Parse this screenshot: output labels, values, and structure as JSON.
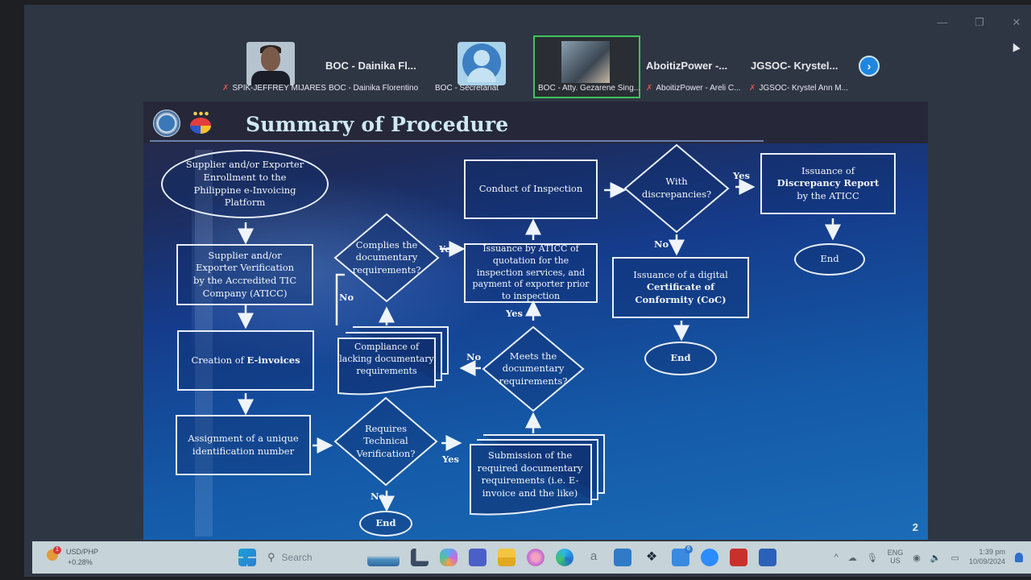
{
  "window_controls": {
    "minimize": "—",
    "maximize": "❐",
    "close": "✕"
  },
  "participants": {
    "tiles": [
      {
        "caption": "SPIK-JEFFREY MIJARES",
        "muted": true,
        "display": "photo",
        "icon": "person-photo"
      },
      {
        "big_name": "BOC - Dainika Fl...",
        "caption": "BOC - Dainika Florentino",
        "muted": false,
        "display": "name"
      },
      {
        "caption": "BOC - Secretariat",
        "muted": false,
        "display": "avatar",
        "icon": "default-avatar-icon"
      },
      {
        "caption": "BOC - Atty. Gezarene Sing...",
        "muted": false,
        "display": "video",
        "active_speaker": true
      },
      {
        "big_name": "AboitizPower -...",
        "caption": "AboitizPower - Areli C...",
        "muted": true,
        "display": "name"
      },
      {
        "big_name": "JGSOC- Krystel...",
        "caption": "JGSOC- Krystel Ann M...",
        "muted": true,
        "display": "name"
      }
    ],
    "next_icon": "›",
    "active_speaker_color": "#3fc35b",
    "muted_icon": "🎙"
  },
  "slide": {
    "title": "Summary of Procedure",
    "page_number": "2",
    "logos": [
      "bureau-of-customs-seal",
      "bagong-pilipinas-logo"
    ],
    "flowchart": {
      "start": "Supplier and/or Exporter Enrollment to the Philippine e-Invoicing Platform",
      "verification": "Supplier and/or Exporter Verification by the Accredited TIC Company (ATICC)",
      "creation": {
        "prefix": "Creation of ",
        "bold": "E-invoices"
      },
      "assignment": "Assignment of a unique identification number",
      "requires_tech": "Requires Technical Verification?",
      "submission": "Submission of the required documentary requirements (i.e. E-invoice and the like)",
      "meets_docs": "Meets the documentary requirements?",
      "compliance_lacking": "Compliance of lacking documentary requirements",
      "complies_docs": "Complies the documentary requirements?",
      "quotation": "Issuance by ATICC of quotation for the inspection services, and payment of exporter prior to inspection",
      "inspection": "Conduct of Inspection",
      "discrepancies": "With discrepancies?",
      "discrepancy_report": {
        "line1": "Issuance of",
        "bold": "Discrepancy Report",
        "line3": "by the ATICC"
      },
      "coc": {
        "line1": "Issuance of a digital",
        "bold": "Certificate of Conformity (CoC)"
      },
      "end": "End",
      "labels": {
        "yes": "Yes",
        "no": "No"
      }
    }
  },
  "taskbar": {
    "widget": {
      "badge": "1",
      "line1": "USD/PHP",
      "line2": "+0.28%"
    },
    "search_placeholder": "Search",
    "apps": [
      "windows-start",
      "search",
      "ship-widget",
      "l-app",
      "copilot",
      "teams",
      "file-explorer",
      "firefox",
      "edge",
      "amazon",
      "store",
      "dropbox",
      "teams-badge",
      "zoom",
      "acrobat",
      "word"
    ],
    "teams_badge": "6",
    "tray": {
      "chevron": "^",
      "lang_line1": "ENG",
      "lang_line2": "US",
      "time": "1:39 pm",
      "date": "10/09/2024"
    }
  }
}
